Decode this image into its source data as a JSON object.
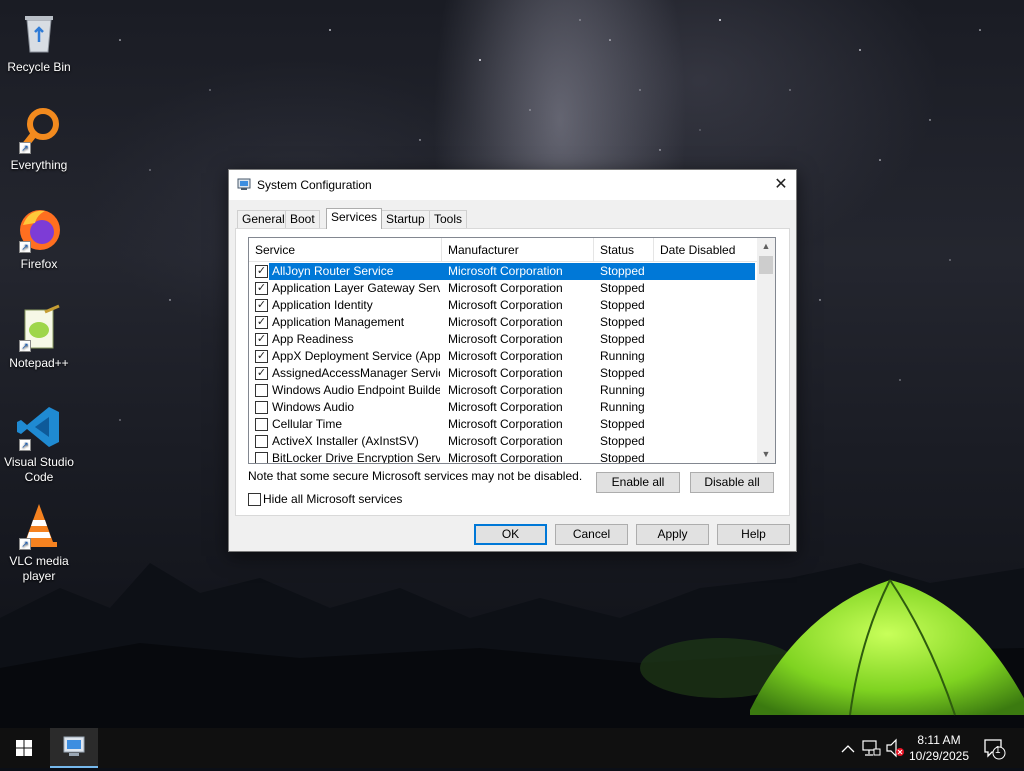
{
  "desktop": {
    "icons": [
      {
        "label": "Recycle Bin",
        "icon": "recycle-bin-icon"
      },
      {
        "label": "Everything",
        "icon": "everything-search-icon"
      },
      {
        "label": "Firefox",
        "icon": "firefox-icon"
      },
      {
        "label": "Notepad++",
        "icon": "notepad-plus-plus-icon"
      },
      {
        "label": "Visual Studio Code",
        "icon": "vscode-icon"
      },
      {
        "label": "VLC media player",
        "icon": "vlc-icon"
      }
    ]
  },
  "dialog": {
    "title": "System Configuration",
    "close_glyph": "✕",
    "tabs": [
      "General",
      "Boot",
      "Services",
      "Startup",
      "Tools"
    ],
    "active_tab": "Services",
    "columns": [
      "Service",
      "Manufacturer",
      "Status",
      "Date Disabled"
    ],
    "services": [
      {
        "name": "AllJoyn Router Service",
        "manufacturer": "Microsoft Corporation",
        "status": "Stopped",
        "date_disabled": "",
        "checked": true,
        "selected": true
      },
      {
        "name": "Application Layer Gateway Service",
        "manufacturer": "Microsoft Corporation",
        "status": "Stopped",
        "date_disabled": "",
        "checked": true,
        "selected": false
      },
      {
        "name": "Application Identity",
        "manufacturer": "Microsoft Corporation",
        "status": "Stopped",
        "date_disabled": "",
        "checked": true,
        "selected": false
      },
      {
        "name": "Application Management",
        "manufacturer": "Microsoft Corporation",
        "status": "Stopped",
        "date_disabled": "",
        "checked": true,
        "selected": false
      },
      {
        "name": "App Readiness",
        "manufacturer": "Microsoft Corporation",
        "status": "Stopped",
        "date_disabled": "",
        "checked": true,
        "selected": false
      },
      {
        "name": "AppX Deployment Service (AppX...",
        "manufacturer": "Microsoft Corporation",
        "status": "Running",
        "date_disabled": "",
        "checked": true,
        "selected": false
      },
      {
        "name": "AssignedAccessManager Service",
        "manufacturer": "Microsoft Corporation",
        "status": "Stopped",
        "date_disabled": "",
        "checked": true,
        "selected": false
      },
      {
        "name": "Windows Audio Endpoint Builder",
        "manufacturer": "Microsoft Corporation",
        "status": "Running",
        "date_disabled": "",
        "checked": false,
        "selected": false
      },
      {
        "name": "Windows Audio",
        "manufacturer": "Microsoft Corporation",
        "status": "Running",
        "date_disabled": "",
        "checked": false,
        "selected": false
      },
      {
        "name": "Cellular Time",
        "manufacturer": "Microsoft Corporation",
        "status": "Stopped",
        "date_disabled": "",
        "checked": false,
        "selected": false
      },
      {
        "name": "ActiveX Installer (AxInstSV)",
        "manufacturer": "Microsoft Corporation",
        "status": "Stopped",
        "date_disabled": "",
        "checked": false,
        "selected": false
      },
      {
        "name": "BitLocker Drive Encryption Service",
        "manufacturer": "Microsoft Corporation",
        "status": "Stopped",
        "date_disabled": "",
        "checked": false,
        "selected": false
      }
    ],
    "note": "Note that some secure Microsoft services may not be disabled.",
    "enable_all": "Enable all",
    "disable_all": "Disable all",
    "hide_ms_label": "Hide all Microsoft services",
    "hide_ms_checked": false,
    "buttons": {
      "ok": "OK",
      "cancel": "Cancel",
      "apply": "Apply",
      "help": "Help"
    }
  },
  "taskbar": {
    "time": "8:11 AM",
    "date": "10/29/2025",
    "notification_count": "1"
  },
  "colors": {
    "selection": "#0078d7",
    "tent": "#7fd321"
  }
}
